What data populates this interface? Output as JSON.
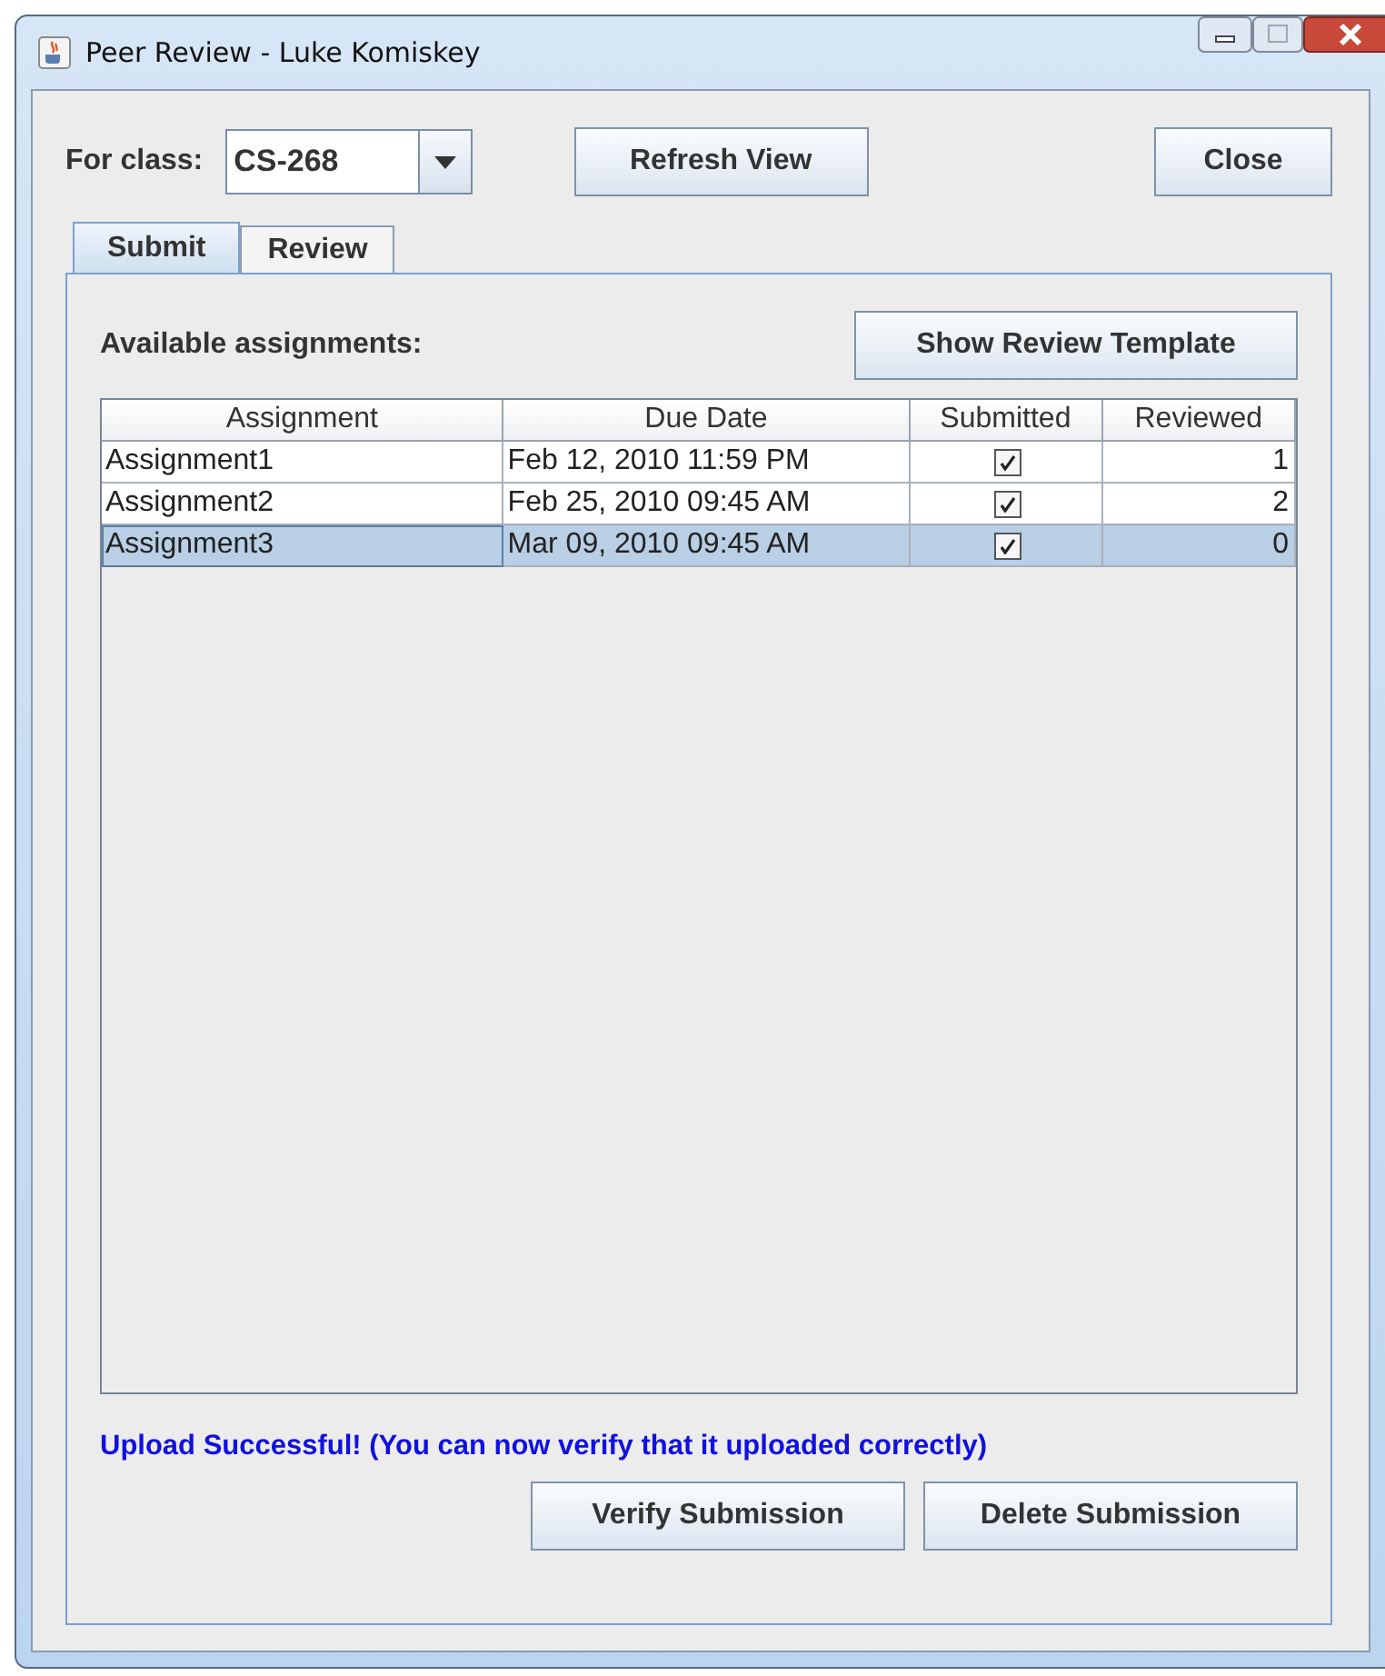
{
  "window": {
    "title": "Peer Review - Luke Komiskey"
  },
  "class_picker": {
    "label": "For class:",
    "value": "CS-268"
  },
  "toolbar_buttons": [
    "Refresh View",
    "Close"
  ],
  "tabs": [
    {
      "label": "Submit",
      "selected": true
    },
    {
      "label": "Review",
      "selected": false
    }
  ],
  "section_label": "Available assignments:",
  "template_button": "Show Review Template",
  "table": {
    "columns": [
      "Assignment",
      "Due Date",
      "Submitted",
      "Reviewed"
    ],
    "rows": [
      {
        "assignment": "Assignment1",
        "due": "Feb 12, 2010 11:59 PM",
        "submitted": true,
        "reviewed": "1",
        "selected": false
      },
      {
        "assignment": "Assignment2",
        "due": "Feb 25, 2010 09:45 AM",
        "submitted": true,
        "reviewed": "2",
        "selected": false
      },
      {
        "assignment": "Assignment3",
        "due": "Mar 09, 2010 09:45 AM",
        "submitted": true,
        "reviewed": "0",
        "selected": true
      }
    ]
  },
  "status_message": "Upload Successful! (You can now verify that it uploaded correctly)",
  "bottom_buttons": [
    "Verify Submission",
    "Delete Submission"
  ]
}
